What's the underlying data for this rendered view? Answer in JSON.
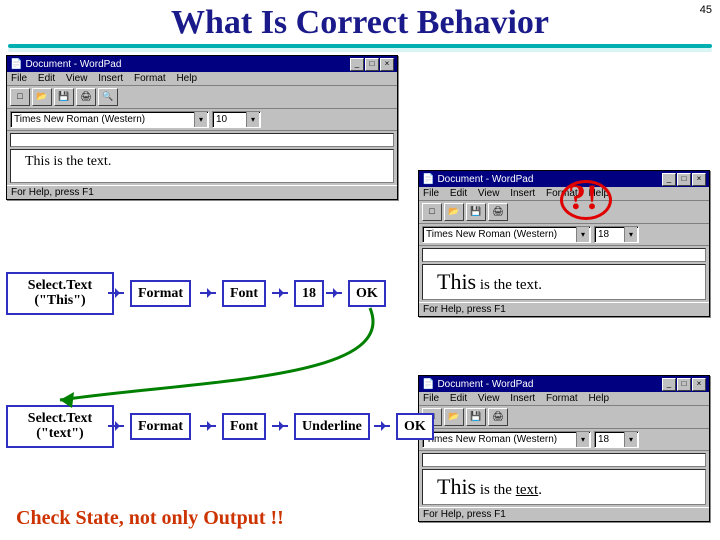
{
  "slide": {
    "title": "What Is Correct Behavior",
    "page": "45",
    "bottom_message": "Check State, not only Output !!",
    "callout": "?!"
  },
  "wordpad": {
    "title": "Document - WordPad",
    "menu": {
      "file": "File",
      "edit": "Edit",
      "view": "View",
      "insert": "Insert",
      "format": "Format",
      "help": "Help"
    },
    "font_name": "Times New Roman (Western)",
    "status": "For Help, press F1"
  },
  "doc1": {
    "content": "This is the text.",
    "size": "10"
  },
  "doc2": {
    "prefix": "This",
    "rest": " is the text.",
    "size": "18"
  },
  "doc3": {
    "prefix": "This",
    "mid": " is the ",
    "u": "text",
    "suffix": ".",
    "size": "18"
  },
  "flow": {
    "select_this": "Select.Text\n(\"This\")",
    "select_text": "Select.Text\n(\"text\")",
    "format": "Format",
    "font": "Font",
    "eighteen": "18",
    "ok": "OK",
    "underline": "Underline"
  }
}
